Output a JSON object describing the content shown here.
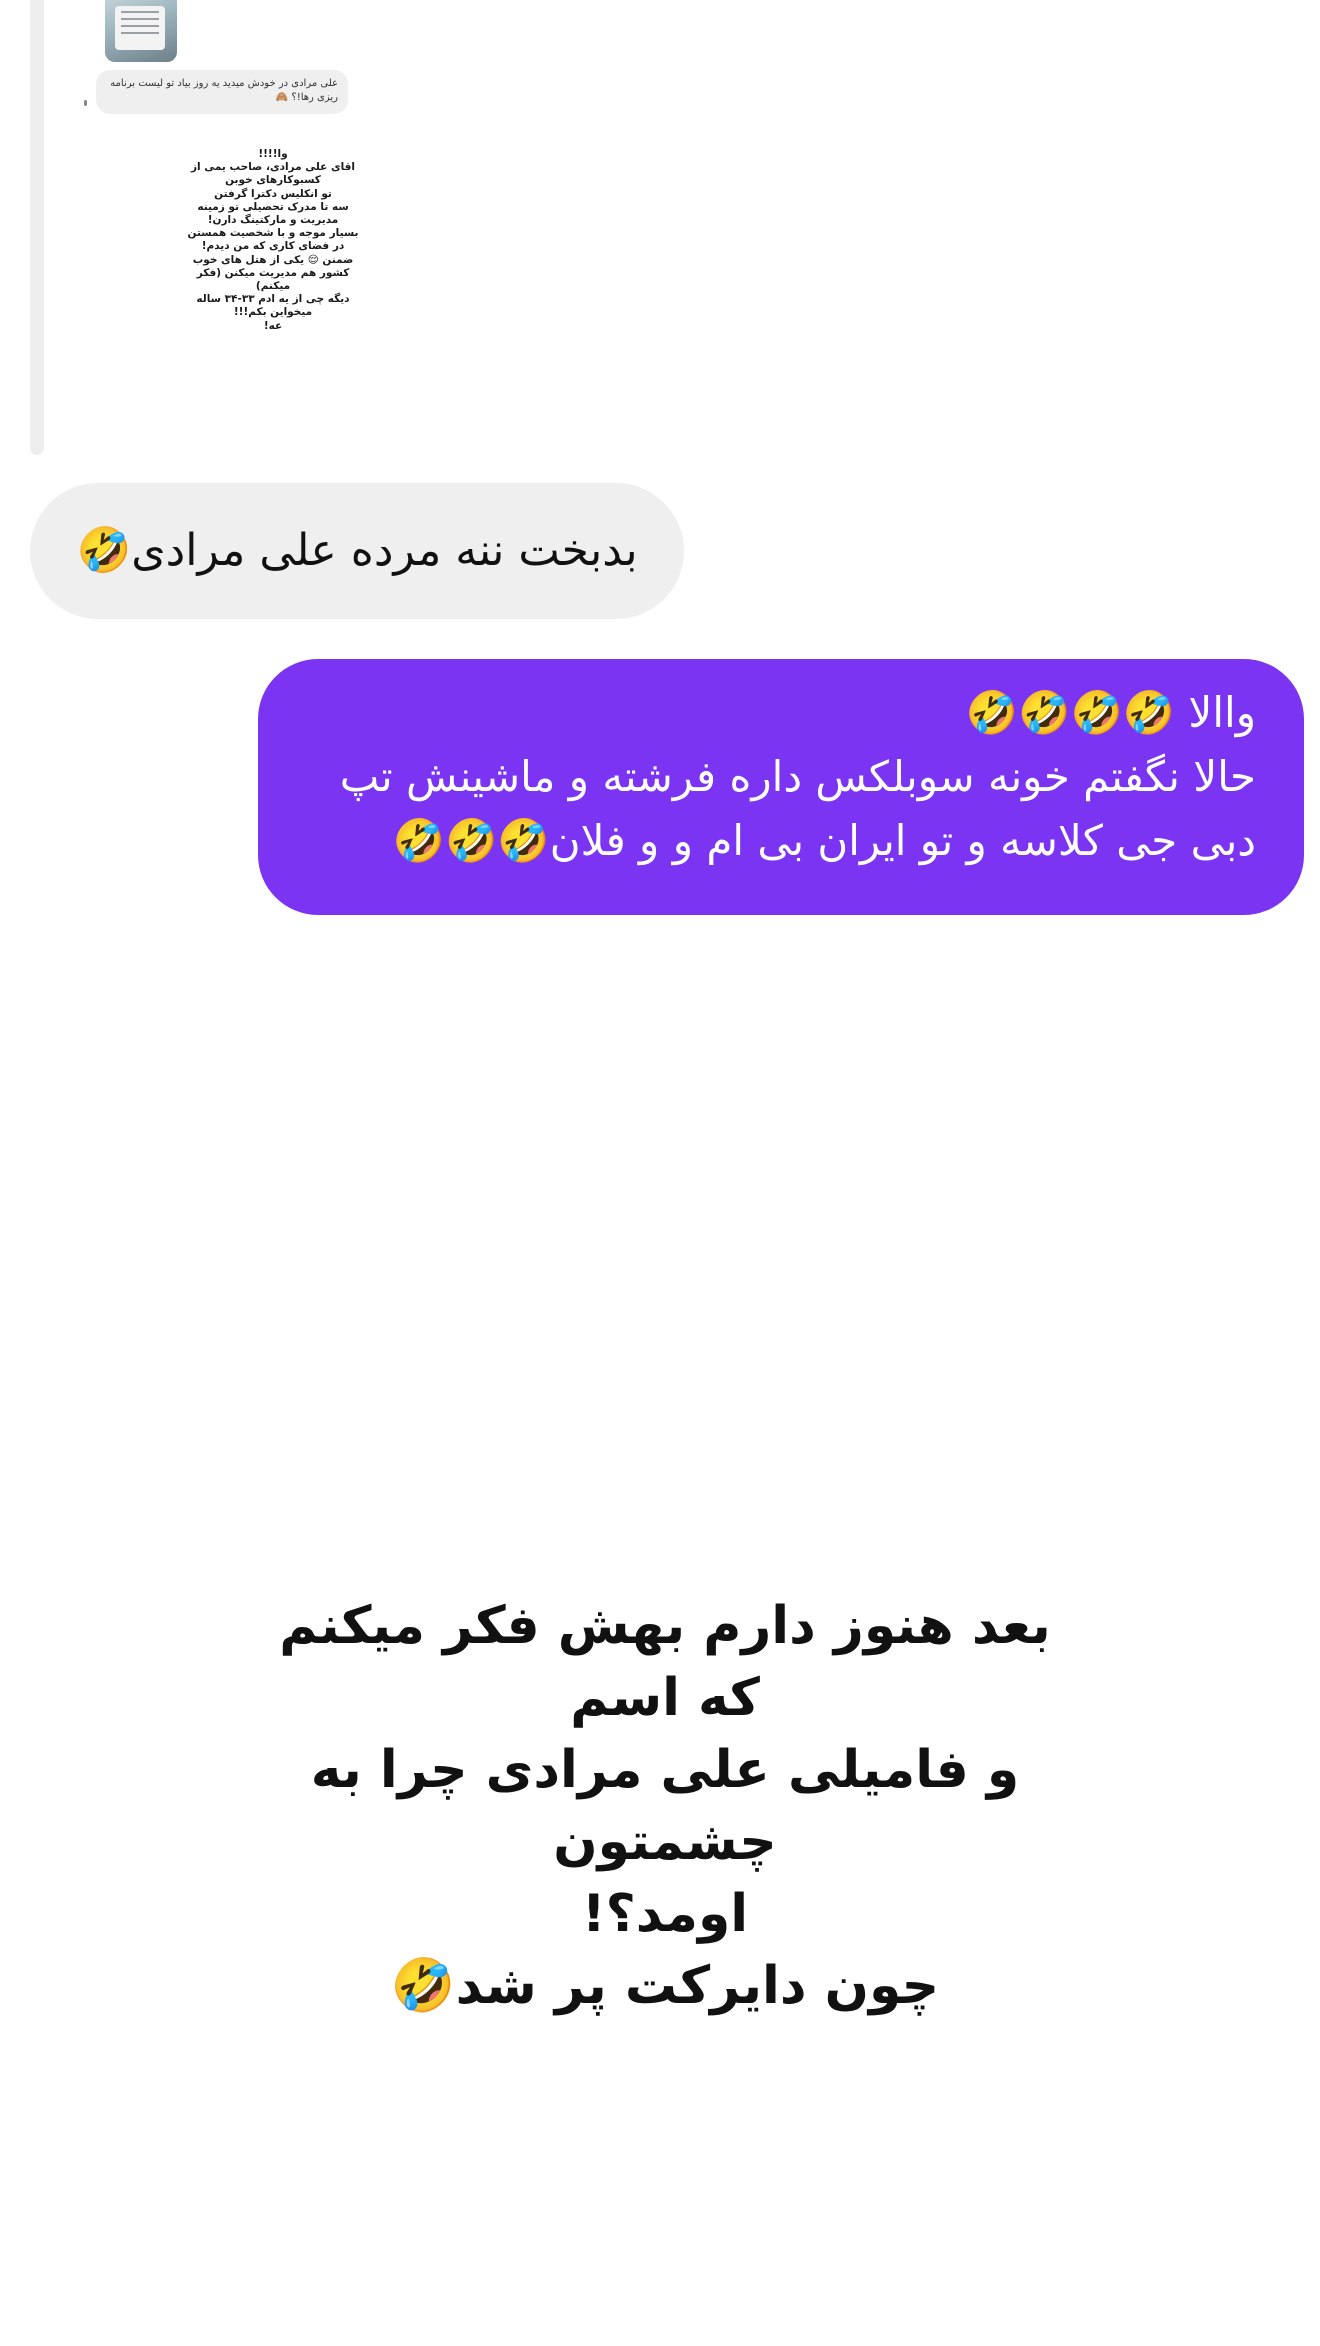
{
  "quoted_story": {
    "reply_text": "علی مرادی در خودش میدید یه روز بیاد تو لیست برنامه ریزی رها!؟ 🙈",
    "story_text": "وا!!!!\nاقای علی مرادی، صاحب یمی از\nکسبوکارهای خوبن\nتو انکلیس دکترا گرفتن\nسه تا مدرک تحصیلی تو زمینه\nمدیریت و مارکتینگ دارن!\nبسیار موجه و با شخصیت همستن\nدر فضای کاری که من دیدم!\nضمنن 😌 یکی از هتل های خوب\nکشور هم مدیریت میکنن (فکر میکنم)\nدیگه چی از یه ادم ۳۳-۳۴ ساله\nمیخواین بکم!!!\nعه!"
  },
  "messages": {
    "received": "بدبخت ننه مرده علی مرادی🤣",
    "sent": "واالا 🤣🤣🤣🤣\nحالا نگفتم خونه سوبلکس داره فرشته و ماشینش تپ\nدبی جی کلاسه و تو ایران بی ام و و فلان🤣🤣🤣"
  },
  "caption": "بعد هنوز دارم بهش فکر میکنم که اسم\nو فامیلی علی مرادی چرا به چشمتون\nاومد؟!\nچون دایرکت پر شد🤣",
  "colors": {
    "sent_bubble": "#7b35f2",
    "received_bubble": "#efefef",
    "background": "#ffffff"
  },
  "icons": {
    "story_thumbnail": "story-thumbnail-image"
  }
}
